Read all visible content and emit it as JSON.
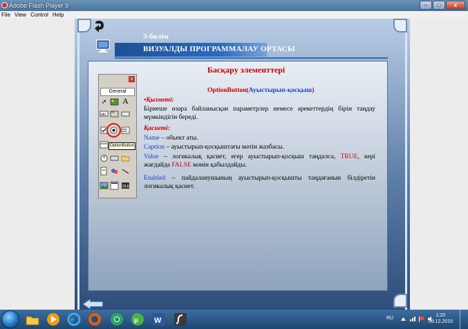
{
  "window": {
    "title": "Adobe Flash Player 9",
    "minimize": "–",
    "maximize": "□",
    "close": "x"
  },
  "menu": [
    "File",
    "View",
    "Control",
    "Help"
  ],
  "slide": {
    "chapter": "3-бөлім",
    "band_title": "ВИЗУАЛДЫ ПРОГРАММАЛАУ ОРТАСЫ",
    "title": "Басқару элементтері",
    "subtitle_red": "OptionButton(",
    "subtitle_blue": "Ауыстырып-қосқыш",
    "subtitle_close": ")",
    "function_label": "•Қызметі:",
    "function_text": "Бірнеше өзара байланысқан параметрлер немесе әрекеттердің бірін таңдау мүмкіндігін береді.",
    "properties_label": "Қасиеті:",
    "properties": [
      {
        "name": "Name",
        "text": " – объект аты."
      },
      {
        "name": "Caption",
        "text": " – ауыстырып-қосқыштағы мәтін жазбасы."
      },
      {
        "name": "Value",
        "text": " –  логикалық қасиет, егер ауыстырып-қосқыш  таңдалса, ",
        "kw1": "TRUE",
        "text2": ", кері жағдайда ",
        "kw2": "FALSE",
        "text3": " мәнін қабылдайды."
      },
      {
        "name": "Enabled",
        "text": " –  пайдаланушының ауыстырып-қосқышты таңдағанын білдіретін логикалық қасиет."
      }
    ]
  },
  "toolbox": {
    "tab_label": "General",
    "close_label": "x",
    "tooltip": "OptionButton",
    "tools": [
      "pointer-tool",
      "picturebox-tool",
      "label-tool",
      "textbox-tool",
      "frame-tool",
      "commandbutton-tool",
      "checkbox-tool",
      "optionbutton-tool",
      "combobox-tool",
      "listbox-tool",
      "timer-tool",
      "drivelistbox-tool",
      "dirlistbox-tool",
      "filelistbox-tool",
      "shape-tool",
      "line-tool",
      "image-tool",
      "data-tool",
      "ole-tool"
    ]
  },
  "taskbar": {
    "apps": [
      "explorer",
      "media-player",
      "ie",
      "firefox",
      "chrome",
      "utorrent",
      "word",
      "flash-player"
    ],
    "lang": "RU",
    "time": "1:20",
    "date": "09.12.2015"
  },
  "colors": {
    "accent_red": "#cc0000",
    "accent_blue": "#1a3fcf",
    "band": "#1f4f94"
  }
}
